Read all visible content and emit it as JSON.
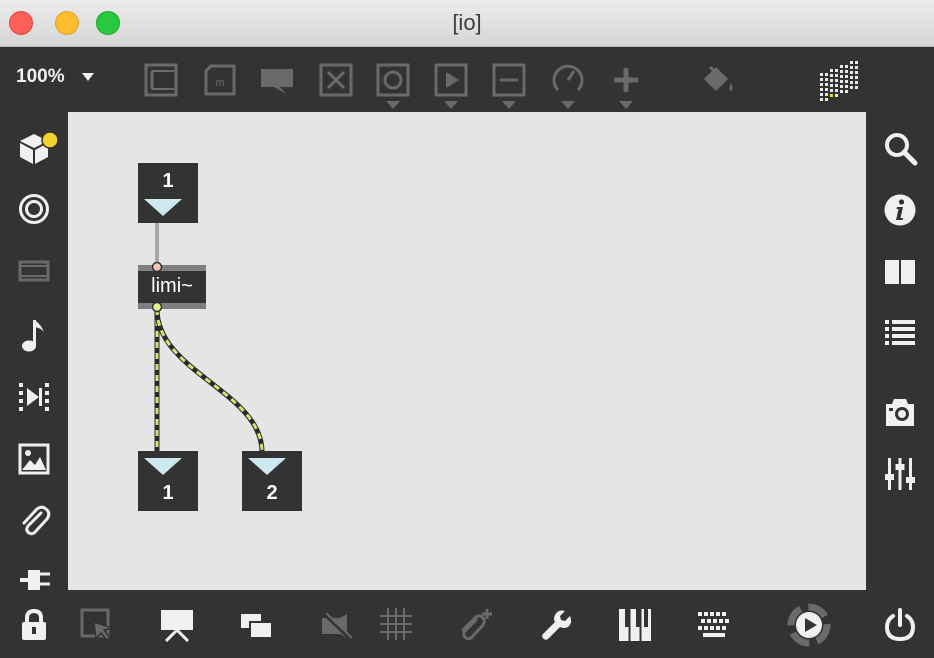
{
  "window": {
    "title": "[io]",
    "traffic_lights": {
      "close": "#fe5f57",
      "minimize": "#febc2e",
      "zoom": "#28c840"
    }
  },
  "toolbar": {
    "zoom_level": "100%",
    "icons": [
      "presentation-view-icon",
      "message-box-icon",
      "comment-icon",
      "toggle-icon",
      "button-icon",
      "play-icon",
      "slider-icon",
      "dial-icon",
      "add-object-icon",
      "paint-bucket-icon",
      "grid-display-icon"
    ]
  },
  "left_sidebar": {
    "icons": [
      "packages-icon",
      "target-icon",
      "film-strip-icon",
      "music-note-icon",
      "step-play-icon",
      "image-icon",
      "paperclip-icon",
      "plug-icon"
    ]
  },
  "right_sidebar": {
    "icons": [
      "search-icon",
      "info-icon",
      "book-icon",
      "list-icon",
      "camera-icon",
      "mixer-icon"
    ]
  },
  "patch": {
    "inlet": {
      "label": "1"
    },
    "object": {
      "label": "limi~"
    },
    "outlet_1": {
      "label": "1"
    },
    "outlet_2": {
      "label": "2"
    },
    "colors": {
      "object_bg": "#333333",
      "triangle": "#cde8ee",
      "signal_cord": "#c8e878",
      "canvas": "#e5e5e5"
    }
  },
  "bottombar": {
    "icons": [
      "lock-icon",
      "edit-pointer-icon",
      "presentation-icon",
      "windows-icon",
      "mute-icon",
      "grid-icon",
      "attach-icon",
      "wrench-icon",
      "piano-icon",
      "keyboard-icon",
      "audio-play-icon",
      "power-icon"
    ]
  }
}
